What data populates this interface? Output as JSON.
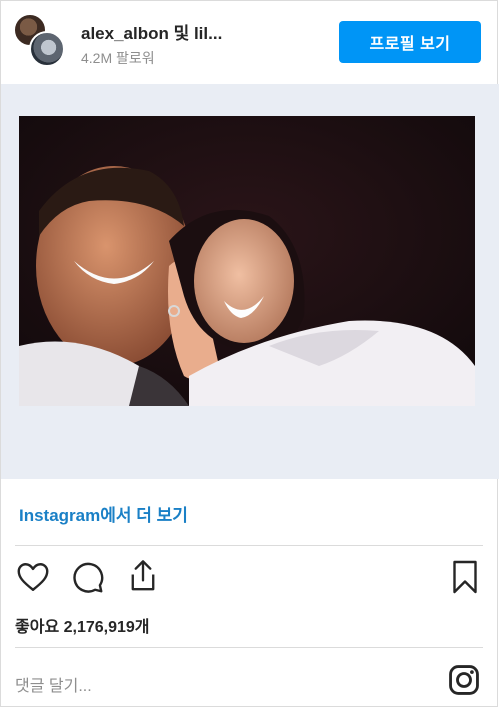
{
  "header": {
    "username": "alex_albon 및 lil...",
    "followers": "4.2M 팔로워",
    "profile_button": "프로필 보기"
  },
  "post": {
    "more_link": "Instagram에서 더 보기",
    "likes": "좋아요 2,176,919개"
  },
  "comment": {
    "placeholder": "댓글 달기..."
  },
  "icons": {
    "like": "heart-icon",
    "comment": "comment-icon",
    "share": "share-icon",
    "save": "bookmark-icon",
    "brand": "instagram-icon"
  },
  "colors": {
    "accent": "#0095f6",
    "link": "#1a80c6",
    "muted": "#8e8e8e"
  }
}
